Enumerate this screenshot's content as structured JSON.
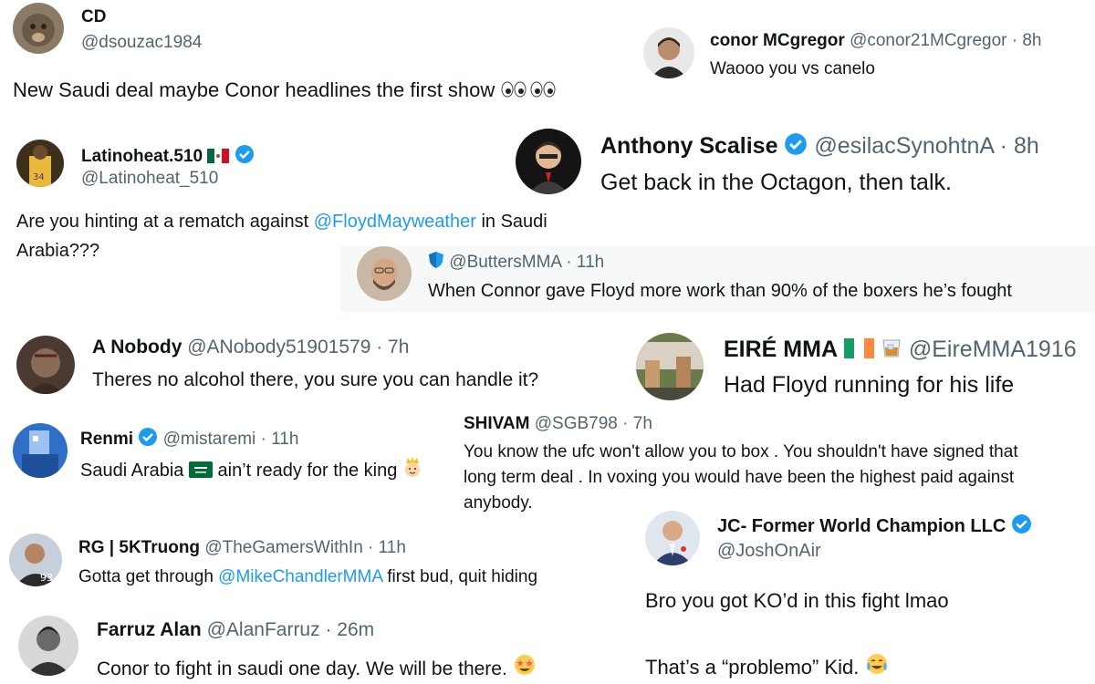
{
  "posts": [
    {
      "name": "CD",
      "handle": "@dsouzac1984",
      "text": "New Saudi deal maybe Conor headlines the first show"
    },
    {
      "name": "conor MCgregor",
      "handle": "@conor21MCgregor · 8h",
      "text": "Waooo you vs canelo"
    },
    {
      "name": "Latinoheat.510",
      "handle": "@Latinoheat_510",
      "text_before": "Are you hinting at a rematch against ",
      "mention": "@FloydMayweather",
      "text_after": " in Saudi",
      "text_line2": "Arabia???"
    },
    {
      "name": "Anthony Scalise",
      "handle": "@esilacSynohtnA · 8h",
      "text": "Get back in the Octagon, then talk."
    },
    {
      "name": "",
      "handle": "@ButtersMMA · 11h",
      "text": "When Connor gave Floyd more work than 90% of the boxers he’s fought"
    },
    {
      "name": "A Nobody",
      "handle": "@ANobody51901579 · 7h",
      "text": "Theres no alcohol there, you sure you can handle it?"
    },
    {
      "name": "EIRÉ MMA",
      "handle": "@EireMMA1916",
      "text": "Had Floyd running for his life"
    },
    {
      "name": "Renmi",
      "handle": "@mistaremi · 11h",
      "text_before": "Saudi Arabia",
      "text_after": "ain’t ready for the king"
    },
    {
      "name": "SHIVAM",
      "handle": "@SGB798 · 7h",
      "lines": [
        "You know the ufc won't allow you to box . You shouldn't have signed that",
        "long term deal . In voxing you would have been the highest paid against",
        "anybody."
      ]
    },
    {
      "name": "RG | 5KTruong",
      "handle": "@TheGamersWithIn · 11h",
      "text_before": "Gotta get through ",
      "mention": "@MikeChandlerMMA",
      "text_after": " first bud, quit hiding"
    },
    {
      "name": "JC- Former World Champion LLC",
      "handle": "@JoshOnAir",
      "text_line1": "Bro you got KO’d in this fight lmao",
      "text_line2": "That’s a “problemo” Kid."
    },
    {
      "name": "Farruz Alan",
      "handle": "@AlanFarruz · 26m",
      "text": "Conor to fight in saudi one day. We will be there."
    }
  ]
}
